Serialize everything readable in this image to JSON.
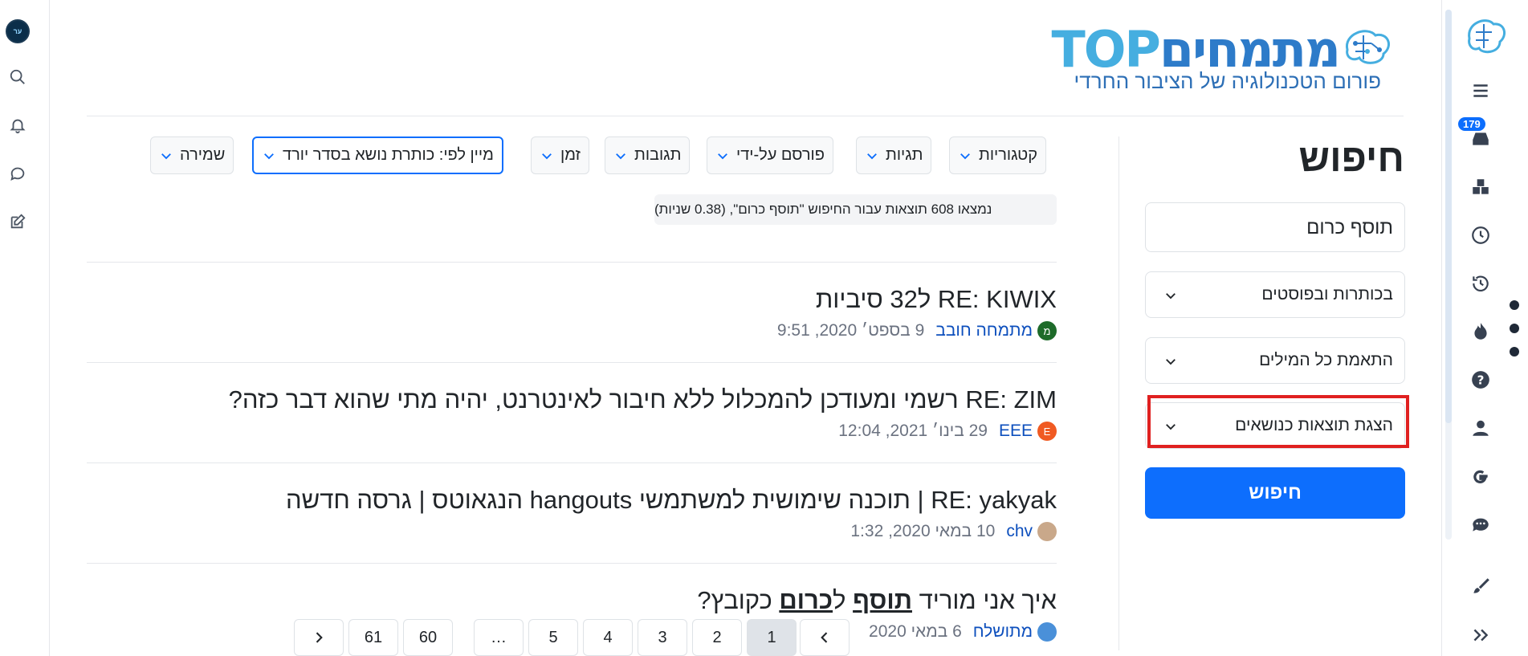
{
  "header": {
    "logo_title_he": "מתמחים",
    "logo_title_en": "TOP",
    "logo_subtitle": "פורום הטכנולוגיה של הציבור החרדי"
  },
  "left_sidebar": {
    "avatar_text": "ער",
    "icons": [
      "search-icon",
      "bell-icon",
      "chat-icon",
      "compose-icon"
    ]
  },
  "right_sidebar": {
    "badge": "179",
    "icons": [
      "menu-icon",
      "inbox-icon",
      "categories-icon",
      "recent-icon",
      "history-icon",
      "popular-icon",
      "help-icon",
      "user-icon",
      "google-icon",
      "chats-icon",
      "brush-icon",
      "expand-icon"
    ]
  },
  "search": {
    "title": "חיפוש",
    "query": "תוסף כרום",
    "in_select": "בכותרות ובפוסטים",
    "match_select": "התאמת כל המילים",
    "show_select": "הצגת תוצאות כנושאים",
    "button": "חיפוש"
  },
  "filters": {
    "categories": "קטגוריות",
    "tags": "תגיות",
    "posted_by": "פורסם על-ידי",
    "replies": "תגובות",
    "time": "זמן",
    "sort": "מיין לפי: כותרת נושא בסדר יורד",
    "save": "שמירה"
  },
  "result_count": "נמצאו 608 תוצאות עבור החיפוש \"תוסף כרום\", (0.38 שניות)",
  "results": [
    {
      "title": "RE: KIWIX ל32 סיביות",
      "user": "מתמחה חובב",
      "avatar_letter": "מ",
      "avatar_color": "#1e6b2a",
      "date": "9 בספט׳ 2020, 9:51"
    },
    {
      "title": "RE: ZIM רשמי ומעודכן להמכלול ללא חיבור לאינטרנט, יהיה מתי שהוא דבר כזה?",
      "user": "EEE",
      "avatar_letter": "E",
      "avatar_color": "#f05a22",
      "date": "29 בינו׳ 2021, 12:04"
    },
    {
      "title": "RE: yakyak | תוכנה שימושית למשתמשי hangouts הנגאוטס | גרסה חדשה",
      "user": "chv",
      "avatar_letter": "",
      "avatar_color": "#c9a88a",
      "date": "10 במאי 2020, 1:32"
    },
    {
      "title_pre": "איך אני מוריד ",
      "title_hl1": "תוסף",
      "title_mid": " ל",
      "title_hl2": "כרום",
      "title_post": " כקובץ?",
      "user": "מתושלח",
      "avatar_letter": "",
      "avatar_color": "#4a90d9",
      "date": "6 במאי 2020"
    }
  ],
  "pagination": {
    "pages": [
      "1",
      "2",
      "3",
      "4",
      "5",
      "…",
      "60",
      "61"
    ],
    "current": "1"
  }
}
